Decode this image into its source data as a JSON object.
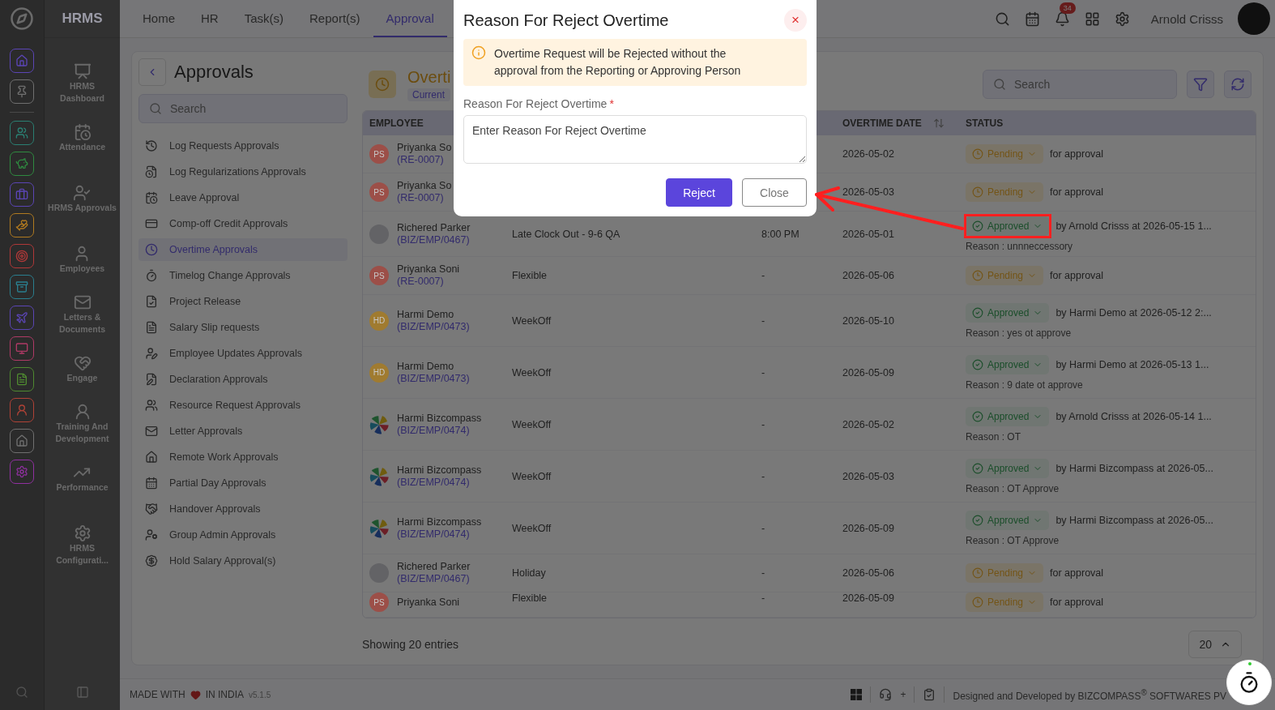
{
  "rail": {
    "items": [
      {
        "color": "#5b45b5"
      },
      {
        "color": "#707070"
      },
      {
        "color": "#2a7f72"
      },
      {
        "color": "#2f8a40"
      },
      {
        "color": "#5b45b5"
      },
      {
        "color": "#b07a20"
      },
      {
        "color": "#b03838"
      },
      {
        "color": "#2a7f8f"
      },
      {
        "color": "#5b45b5"
      },
      {
        "color": "#b03a66"
      },
      {
        "color": "#4f8a30"
      },
      {
        "color": "#b04236"
      },
      {
        "color": "#707070"
      },
      {
        "color": "#9030a0"
      }
    ]
  },
  "nav": {
    "title": "HRMS",
    "items": [
      {
        "label": "HRMS Dashboard"
      },
      {
        "label": "Attendance"
      },
      {
        "label": "HRMS Approvals"
      },
      {
        "label": "Employees"
      },
      {
        "label": "Letters & Documents"
      },
      {
        "label": "Engage"
      },
      {
        "label": "Training And Development"
      },
      {
        "label": "Performance"
      },
      {
        "label": "HRMS Configurati..."
      }
    ]
  },
  "topbar": {
    "tabs": [
      {
        "label": "Home",
        "selected": false
      },
      {
        "label": "HR",
        "selected": false
      },
      {
        "label": "Task(s)",
        "selected": false
      },
      {
        "label": "Report(s)",
        "selected": false
      },
      {
        "label": "Approval",
        "selected": true
      }
    ],
    "notifications": "34",
    "user": "Arnold Crisss"
  },
  "approvals": {
    "title": "Approvals",
    "search": {
      "placeholder": "Search"
    },
    "items": [
      {
        "label": "Log Requests Approvals",
        "selected": false
      },
      {
        "label": "Log Regularizations Approvals",
        "selected": false
      },
      {
        "label": "Leave Approval",
        "selected": false
      },
      {
        "label": "Comp-off Credit Approvals",
        "selected": false
      },
      {
        "label": "Overtime Approvals",
        "selected": true
      },
      {
        "label": "Timelog Change Approvals",
        "selected": false
      },
      {
        "label": "Project Release",
        "selected": false
      },
      {
        "label": "Salary Slip requests",
        "selected": false
      },
      {
        "label": "Employee Updates Approvals",
        "selected": false
      },
      {
        "label": "Declaration Approvals",
        "selected": false
      },
      {
        "label": "Resource Request Approvals",
        "selected": false
      },
      {
        "label": "Letter Approvals",
        "selected": false
      },
      {
        "label": "Remote Work Approvals",
        "selected": false
      },
      {
        "label": "Partial Day Approvals",
        "selected": false
      },
      {
        "label": "Handover Approvals",
        "selected": false
      },
      {
        "label": "Group Admin Approvals",
        "selected": false
      },
      {
        "label": "Hold Salary Approval(s)",
        "selected": false
      }
    ]
  },
  "page": {
    "title": "Overti",
    "subtitle": "Current",
    "search": {
      "placeholder": "Search"
    }
  },
  "table": {
    "columns": [
      {
        "label": "EMPLOYEE"
      },
      {
        "label": "OVERTIME DATE"
      },
      {
        "label": "STATUS"
      }
    ],
    "rows": [
      {
        "name": "Priyanka So",
        "id": "(RE-0007)",
        "avatar": {
          "kind": "initials",
          "text": "PS",
          "color": "#9c4f48"
        },
        "date": "2026-05-02",
        "status": {
          "kind": "pending",
          "label": "Pending",
          "note": "for approval"
        }
      },
      {
        "name": "Priyanka So",
        "id": "(RE-0007)",
        "avatar": {
          "kind": "initials",
          "text": "PS",
          "color": "#9c4f48"
        },
        "date": "2026-05-03",
        "status": {
          "kind": "pending",
          "label": "Pending",
          "note": "for approval"
        }
      },
      {
        "name": "Richered Parker",
        "id": "(BIZ/EMP/0467)",
        "avatar": {
          "kind": "blank"
        },
        "type": "Late Clock Out - 9-6 QA",
        "time": "8:00 PM",
        "date": "2026-05-01",
        "status": {
          "kind": "approved",
          "label": "Approved",
          "note": "by Arnold Crisss at 2026-05-15 1...",
          "reason": "Reason : unnneccessory"
        }
      },
      {
        "name": "Priyanka Soni",
        "id": "(RE-0007)",
        "avatar": {
          "kind": "initials",
          "text": "PS",
          "color": "#9c4f48"
        },
        "type": "Flexible",
        "time": "-",
        "date": "2026-05-06",
        "status": {
          "kind": "pending",
          "label": "Pending",
          "note": "for approval"
        }
      },
      {
        "name": "Harmi Demo",
        "id": "(BIZ/EMP/0473)",
        "avatar": {
          "kind": "initials",
          "text": "HD",
          "color": "#a07b30"
        },
        "type": "WeekOff",
        "time": "-",
        "date": "2026-05-10",
        "status": {
          "kind": "approved",
          "label": "Approved",
          "note": "by Harmi Demo at 2026-05-12 2:...",
          "reason": "Reason : yes ot approve"
        }
      },
      {
        "name": "Harmi Demo",
        "id": "(BIZ/EMP/0473)",
        "avatar": {
          "kind": "initials",
          "text": "HD",
          "color": "#a07b30"
        },
        "type": "WeekOff",
        "time": "-",
        "date": "2026-05-09",
        "status": {
          "kind": "approved",
          "label": "Approved",
          "note": "by Harmi Demo at 2026-05-13 1...",
          "reason": "Reason : 9 date ot approve"
        }
      },
      {
        "name": "Harmi Bizcompass",
        "id": "(BIZ/EMP/0474)",
        "avatar": {
          "kind": "pinwheel"
        },
        "type": "WeekOff",
        "time": "-",
        "date": "2026-05-02",
        "status": {
          "kind": "approved",
          "label": "Approved",
          "note": "by Arnold Crisss at 2026-05-14 1...",
          "reason": "Reason : OT"
        }
      },
      {
        "name": "Harmi Bizcompass",
        "id": "(BIZ/EMP/0474)",
        "avatar": {
          "kind": "pinwheel"
        },
        "type": "WeekOff",
        "time": "-",
        "date": "2026-05-03",
        "status": {
          "kind": "approved",
          "label": "Approved",
          "note": "by Harmi Bizcompass at 2026-05...",
          "reason": "Reason : OT Approve"
        }
      },
      {
        "name": "Harmi Bizcompass",
        "id": "(BIZ/EMP/0474)",
        "avatar": {
          "kind": "pinwheel"
        },
        "type": "WeekOff",
        "time": "-",
        "date": "2026-05-09",
        "status": {
          "kind": "approved",
          "label": "Approved",
          "note": "by Harmi Bizcompass at 2026-05...",
          "reason": "Reason : OT Approve"
        }
      },
      {
        "name": "Richered Parker",
        "id": "(BIZ/EMP/0467)",
        "avatar": {
          "kind": "blank"
        },
        "type": "Holiday",
        "time": "-",
        "date": "2026-05-06",
        "status": {
          "kind": "pending",
          "label": "Pending",
          "note": "for approval"
        }
      },
      {
        "name": "Priyanka Soni",
        "avatar": {
          "kind": "initials",
          "text": "PS",
          "color": "#9c4f48"
        },
        "type": "Flexible",
        "time": "-",
        "date": "2026-05-09",
        "status": {
          "kind": "pending",
          "label": "Pending",
          "note": "for approval"
        }
      }
    ]
  },
  "table_footer": {
    "entries": "Showing 20 entries",
    "page_size": "20"
  },
  "footer": {
    "made_with": "MADE WITH",
    "in_india": "IN INDIA",
    "version": "v5.1.5",
    "plus": "+",
    "credit": "Designed and Developed by  BIZCOMPASS$^{®}$ SOFTWARES PV"
  },
  "dialog": {
    "title": "Reason For Reject Overtime",
    "close": "×",
    "alert": "Overtime Request will be Rejected without the approval from the Reporting or Approving Person",
    "field_label": "Reason For Reject Overtime",
    "required_mark": "*",
    "placeholder": "Enter Reason For Reject Overtime",
    "buttons": [
      {
        "label": "Reject",
        "kind": "primary"
      },
      {
        "label": "Close",
        "kind": "secondary"
      }
    ]
  }
}
